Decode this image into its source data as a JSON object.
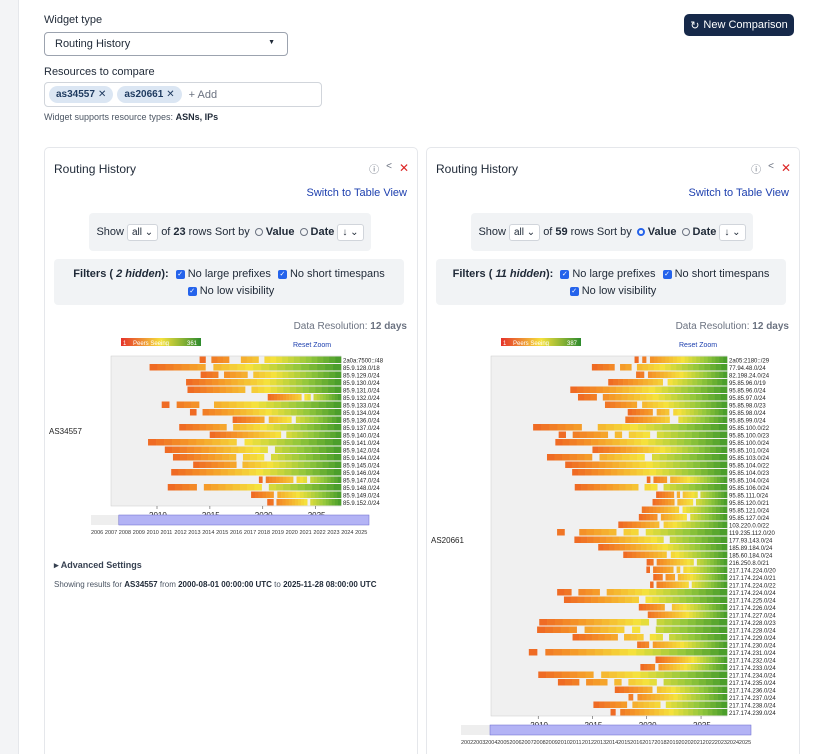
{
  "widget_type_label": "Widget type",
  "widget_type_value": "Routing History",
  "new_comparison_label": "New Comparison",
  "resources_label": "Resources to compare",
  "resources": [
    "as34557",
    "as20661"
  ],
  "add_placeholder": "+ Add",
  "support_prefix": "Widget supports resource types:",
  "support_types": "ASNs, IPs",
  "panels": [
    {
      "title": "Routing History",
      "switch_label": "Switch to Table View",
      "show_prefix": "Show",
      "show_value": "all",
      "of_label": "of",
      "rows_count": "23",
      "rows_sort_label": "rows Sort by",
      "sort_value": "Value",
      "sort_date": "Date",
      "sort_dir": "↓",
      "sort_selected": "Date",
      "filters_prefix": "Filters (",
      "hidden_text": "2 hidden",
      "filters_suffix": "):",
      "filter1": "No large prefixes",
      "filter2": "No short timespans",
      "filter3": "No low visibility",
      "data_res_label": "Data Resolution:",
      "data_res_value": "12 days",
      "legend_min": "1",
      "legend_label": "Peers Seeing",
      "legend_max": "361",
      "reset_zoom": "Reset Zoom",
      "asn_label": "AS34557",
      "advanced_label": "Advanced Settings",
      "showing_prefix": "Showing results for",
      "showing_asn": "AS34557",
      "showing_from": "from",
      "showing_start": "2000-08-01 00:00:00 UTC",
      "showing_to": "to",
      "showing_end": "2025-11-28 08:00:00 UTC"
    },
    {
      "title": "Routing History",
      "switch_label": "Switch to Table View",
      "show_prefix": "Show",
      "show_value": "all",
      "of_label": "of",
      "rows_count": "59",
      "rows_sort_label": "rows Sort by",
      "sort_value": "Value",
      "sort_date": "Date",
      "sort_dir": "↓",
      "sort_selected": "Value",
      "filters_prefix": "Filters (",
      "hidden_text": "11 hidden",
      "filters_suffix": "):",
      "filter1": "No large prefixes",
      "filter2": "No short timespans",
      "filter3": "No low visibility",
      "data_res_label": "Data Resolution:",
      "data_res_value": "12 days",
      "legend_min": "1",
      "legend_label": "Peers Seeing",
      "legend_max": "387",
      "reset_zoom": "Reset Zoom",
      "asn_label": "AS20661"
    }
  ],
  "chart_data": [
    {
      "type": "heatmap",
      "x_ticks": [
        "2010",
        "2015",
        "2020",
        "2025"
      ],
      "y_label": "AS34557",
      "nav_ticks": [
        "2006",
        "2007",
        "2008",
        "2009",
        "2010",
        "2011",
        "2012",
        "2013",
        "2014",
        "2015",
        "2016",
        "2017",
        "2018",
        "2019",
        "2020",
        "2021",
        "2022",
        "2023",
        "2024",
        "2025"
      ],
      "rows": [
        "2a0a:7500::/48",
        "85.9.128.0/18",
        "85.9.129.0/24",
        "85.9.130.0/24",
        "85.9.131.0/24",
        "85.9.132.0/24",
        "85.9.133.0/24",
        "85.9.134.0/24",
        "85.9.136.0/24",
        "85.9.137.0/24",
        "85.9.140.0/24",
        "85.9.141.0/24",
        "85.9.142.0/24",
        "85.9.144.0/24",
        "85.9.145.0/24",
        "85.9.146.0/24",
        "85.9.147.0/24",
        "85.9.148.0/24",
        "85.9.149.0/24",
        "85.9.152.0/24"
      ]
    },
    {
      "type": "heatmap",
      "x_ticks": [
        "2010",
        "2015",
        "2020",
        "2025"
      ],
      "y_label": "AS20661",
      "nav_ticks": [
        "2002",
        "2003",
        "2004",
        "2005",
        "2006",
        "2007",
        "2008",
        "2009",
        "2010",
        "2011",
        "2012",
        "2013",
        "2014",
        "2015",
        "2016",
        "2017",
        "2018",
        "2019",
        "2020",
        "2021",
        "2022",
        "2023",
        "2024",
        "2025"
      ],
      "rows": [
        "2a05:2180::/29",
        "77.94.48.0/24",
        "82.198.24.0/24",
        "95.85.96.0/19",
        "95.85.96.0/24",
        "95.85.97.0/24",
        "95.85.98.0/23",
        "95.85.98.0/24",
        "95.85.99.0/24",
        "95.85.100.0/22",
        "95.85.100.0/23",
        "95.85.100.0/24",
        "95.85.101.0/24",
        "95.85.103.0/24",
        "95.85.104.0/22",
        "95.85.104.0/23",
        "95.85.104.0/24",
        "95.85.106.0/24",
        "95.85.111.0/24",
        "95.85.120.0/21",
        "95.85.121.0/24",
        "95.85.127.0/24",
        "103.220.0.0/22",
        "119.235.112.0/20",
        "177.93.143.0/24",
        "185.89.184.0/24",
        "185.60.184.0/24",
        "216.250.8.0/21",
        "217.174.224.0/20",
        "217.174.224.0/21",
        "217.174.224.0/22",
        "217.174.224.0/24",
        "217.174.225.0/24",
        "217.174.226.0/24",
        "217.174.227.0/24",
        "217.174.228.0/23",
        "217.174.228.0/24",
        "217.174.229.0/24",
        "217.174.230.0/24",
        "217.174.231.0/24",
        "217.174.232.0/24",
        "217.174.233.0/24",
        "217.174.234.0/24",
        "217.174.235.0/24",
        "217.174.236.0/24",
        "217.174.237.0/24",
        "217.174.238.0/24",
        "217.174.239.0/24"
      ]
    }
  ]
}
